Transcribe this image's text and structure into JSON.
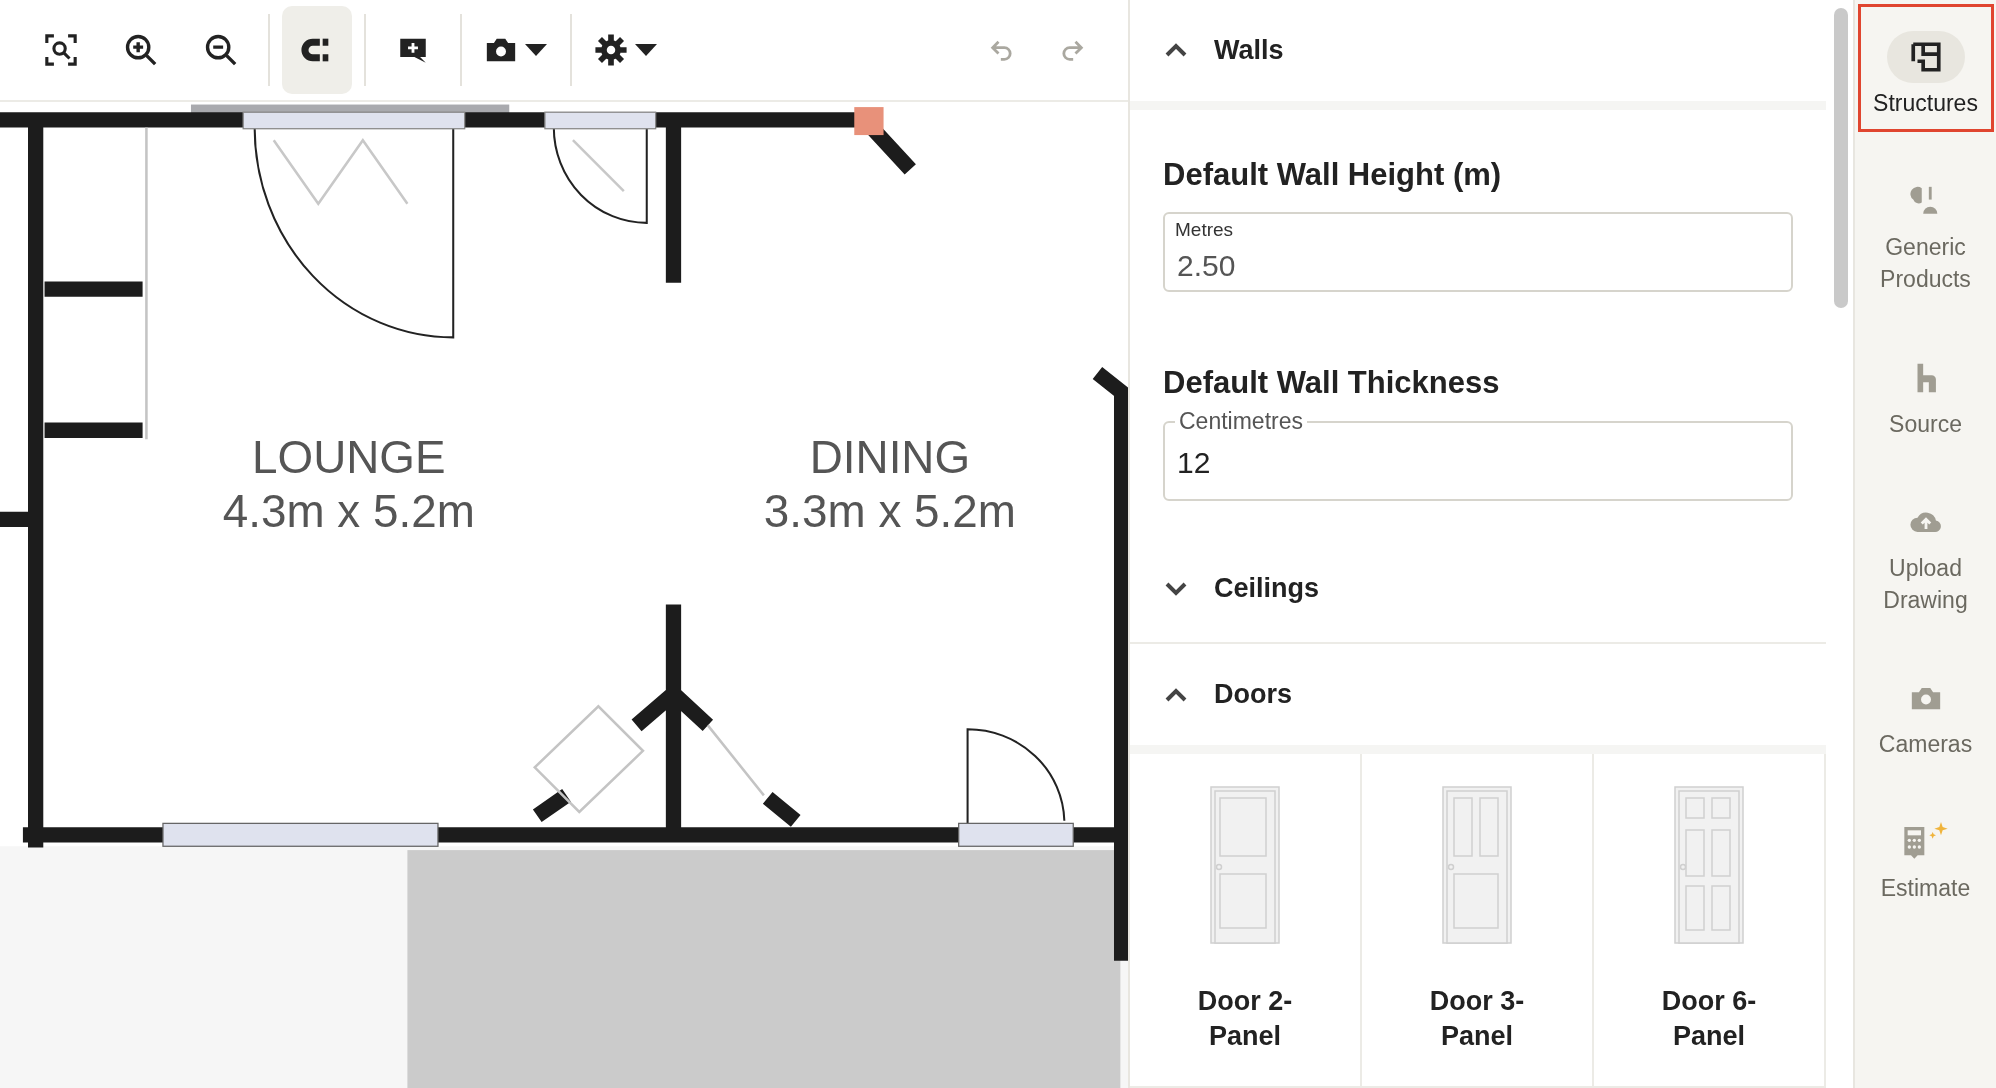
{
  "toolbar": {
    "groups": [
      [
        {
          "kind": "fit",
          "selected": false
        },
        {
          "kind": "zoom-in",
          "selected": false
        },
        {
          "kind": "zoom-out",
          "selected": false
        }
      ],
      [
        {
          "kind": "magnet",
          "selected": true
        }
      ],
      [
        {
          "kind": "comment",
          "selected": false
        }
      ],
      [
        {
          "kind": "camera",
          "selected": false
        }
      ],
      [
        {
          "kind": "settings",
          "selected": false
        }
      ]
    ],
    "history": [
      {
        "kind": "undo",
        "disabled": true
      },
      {
        "kind": "redo",
        "disabled": true
      }
    ]
  },
  "floor_plan": {
    "rooms": [
      {
        "name": "LOUNGE",
        "size": "4.3m x 5.2m"
      },
      {
        "name": "DINING",
        "size": "3.3m x 5.2m"
      }
    ]
  },
  "panel": {
    "sections": [
      {
        "title": "Walls",
        "expanded": true,
        "fields": [
          {
            "label": "Default Wall Height (m)",
            "unit": "Metres",
            "value": "2.50",
            "kind": "filled"
          },
          {
            "label": "Default Wall Thickness",
            "unit": "Centimetres",
            "value": "12",
            "kind": "outlined"
          }
        ]
      },
      {
        "title": "Ceilings",
        "expanded": false
      },
      {
        "title": "Doors",
        "expanded": true,
        "items": [
          {
            "name": "Door 2-Panel",
            "kind": "twopanel"
          },
          {
            "name": "Door 3-Panel",
            "kind": "threepanel"
          },
          {
            "name": "Door 6-Panel",
            "kind": "sixpanel"
          }
        ]
      }
    ]
  },
  "sidebar": {
    "items": [
      {
        "label": "Structures",
        "kind": "structures",
        "selected": true
      },
      {
        "label": "Generic Products",
        "kind": "products",
        "selected": false
      },
      {
        "label": "Source",
        "kind": "source",
        "selected": false
      },
      {
        "label": "Upload Drawing",
        "kind": "upload",
        "selected": false
      },
      {
        "label": "Cameras",
        "kind": "cameras",
        "selected": false
      },
      {
        "label": "Estimate",
        "kind": "estimate",
        "selected": false
      }
    ]
  }
}
